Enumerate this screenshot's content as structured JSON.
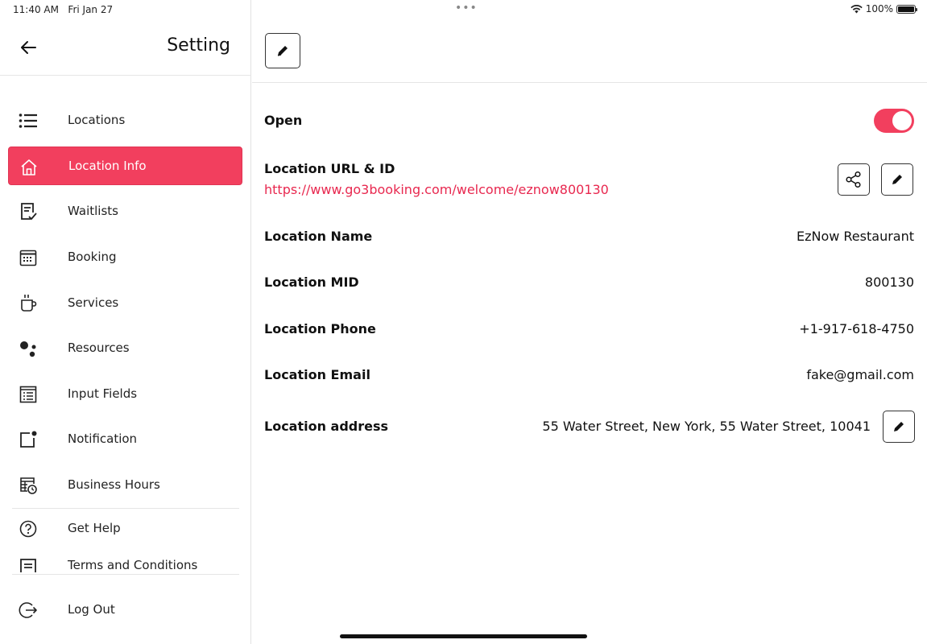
{
  "status_bar": {
    "time": "11:40 AM",
    "date": "Fri Jan 27",
    "battery": "100%",
    "dots": "•••"
  },
  "sidebar": {
    "title": "Setting",
    "items": [
      {
        "label": "Locations",
        "icon": "list-icon"
      },
      {
        "label": "Location Info",
        "icon": "home-icon",
        "active": true
      },
      {
        "label": "Waitlists",
        "icon": "checklist-icon"
      },
      {
        "label": "Booking",
        "icon": "calendar-icon"
      },
      {
        "label": "Services",
        "icon": "coffee-cup-icon"
      },
      {
        "label": "Resources",
        "icon": "dots-cluster-icon"
      },
      {
        "label": "Input Fields",
        "icon": "form-icon"
      },
      {
        "label": "Notification",
        "icon": "notification-icon"
      },
      {
        "label": "Business Hours",
        "icon": "calendar-clock-icon"
      },
      {
        "label": "Get Help",
        "icon": "help-circle-icon"
      },
      {
        "label": "Terms and Conditions",
        "icon": "document-icon"
      }
    ],
    "logout_label": "Log Out"
  },
  "main": {
    "open_label": "Open",
    "open_state": true,
    "url_label": "Location URL & ID",
    "url": "https://www.go3booking.com/welcome/eznow800130",
    "fields": [
      {
        "label": "Location Name",
        "value": "EzNow Restaurant"
      },
      {
        "label": "Location MID",
        "value": "800130"
      },
      {
        "label": "Location Phone",
        "value": "+1-917-618-4750"
      },
      {
        "label": "Location Email",
        "value": "fake@gmail.com"
      }
    ],
    "address_label": "Location address",
    "address_value": "55 Water Street, New York, 55 Water Street, 10041"
  },
  "colors": {
    "accent": "#f23f5e",
    "link": "#e8284f"
  }
}
